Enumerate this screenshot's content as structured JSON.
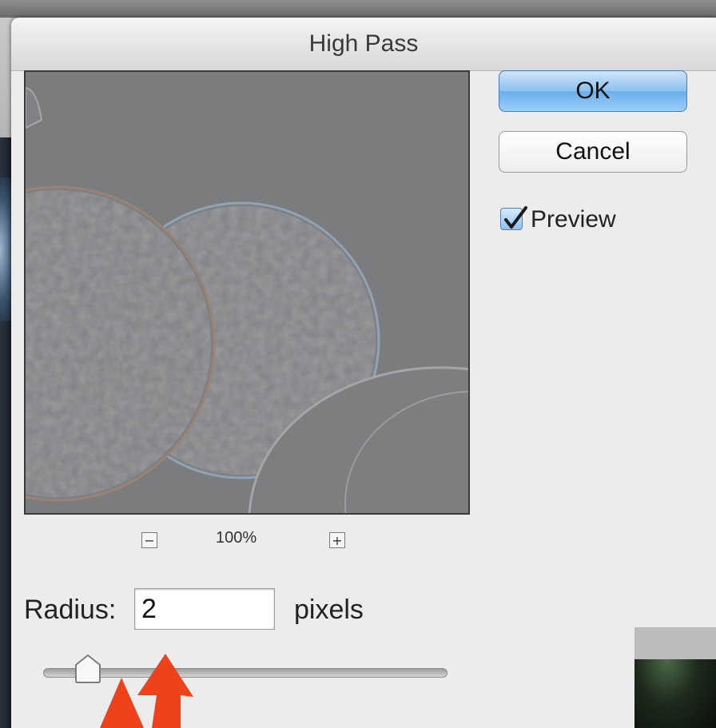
{
  "dialog": {
    "title": "High Pass"
  },
  "buttons": {
    "ok_label": "OK",
    "cancel_label": "Cancel"
  },
  "preview_toggle": {
    "label": "Preview",
    "checked": true
  },
  "zoom": {
    "level": "100%",
    "minus_symbol": "−",
    "plus_symbol": "+"
  },
  "radius": {
    "label": "Radius:",
    "value": "2",
    "unit": "pixels",
    "slider_fraction": 0.11
  },
  "colors": {
    "ok_button": "#8cc1f0",
    "annotation_arrow": "#f0421a",
    "preview_gray": "#7c7d7f"
  },
  "icons": {
    "checkbox": "checkmark-icon",
    "annotation": "red-arrow-icon"
  }
}
